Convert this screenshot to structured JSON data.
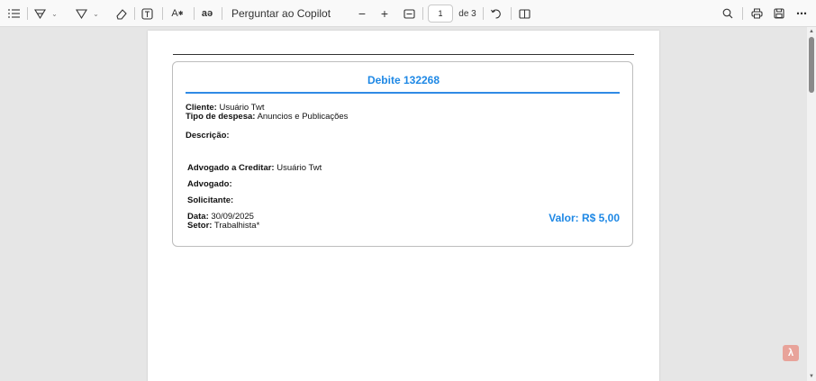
{
  "toolbar": {
    "copilot_label": "Perguntar ao Copilot",
    "page_current": "1",
    "page_total": "de 3",
    "icons": [
      "contents-icon",
      "highlight-icon",
      "draw-icon",
      "erase-icon",
      "text-box-icon",
      "read-aloud-icon",
      "translate-icon",
      "zoom-out-icon",
      "zoom-in-icon",
      "fit-page-icon",
      "rotate-icon",
      "page-view-icon",
      "search-icon",
      "print-icon",
      "save-icon",
      "more-icon"
    ]
  },
  "document": {
    "title": "Debite 132268",
    "cliente_label": "Cliente:",
    "cliente_value": "Usuário Twt",
    "tipo_label": "Tipo de despesa:",
    "tipo_value": "Anuncios e Publicações",
    "descricao_label": "Descrição:",
    "advogado_creditar_label": "Advogado a Creditar:",
    "advogado_creditar_value": "Usuário Twt",
    "advogado_label": "Advogado:",
    "solicitante_label": "Solicitante:",
    "data_label": "Data:",
    "data_value": "30/09/2025",
    "setor_label": "Setor:",
    "setor_value": "Trabalhista*",
    "valor": "Valor: R$ 5,00"
  },
  "colors": {
    "accent": "#1e88e5",
    "toolbar_bg": "#f9f9f9",
    "viewer_bg": "#e6e6e6"
  }
}
